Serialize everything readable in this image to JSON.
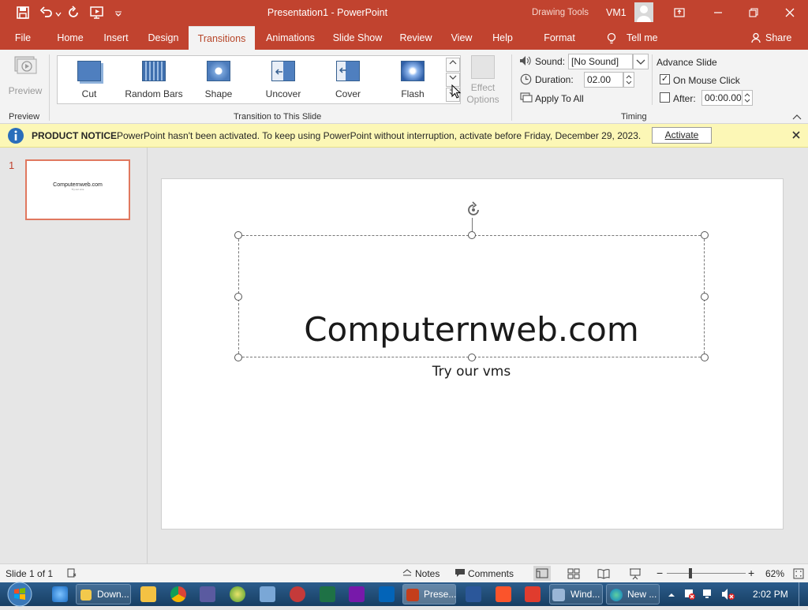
{
  "titlebar": {
    "title": "Presentation1  -  PowerPoint",
    "context_tools": "Drawing Tools",
    "user": "VM1",
    "minimize": "—",
    "restore": "❐",
    "close": "✕",
    "ribbon_display": "⬚"
  },
  "tabs": [
    {
      "label": "File"
    },
    {
      "label": "Home"
    },
    {
      "label": "Insert"
    },
    {
      "label": "Design"
    },
    {
      "label": "Transitions"
    },
    {
      "label": "Animations"
    },
    {
      "label": "Slide Show"
    },
    {
      "label": "Review"
    },
    {
      "label": "View"
    },
    {
      "label": "Help"
    },
    {
      "label": "Format"
    }
  ],
  "tell_me": "Tell me",
  "share": "Share",
  "ribbon": {
    "preview_label": "Preview",
    "preview_group": "Preview",
    "transitions": [
      {
        "label": "Cut"
      },
      {
        "label": "Random Bars"
      },
      {
        "label": "Shape"
      },
      {
        "label": "Uncover"
      },
      {
        "label": "Cover"
      },
      {
        "label": "Flash"
      }
    ],
    "effect_options_line1": "Effect",
    "effect_options_line2": "Options",
    "transition_group": "Transition to This Slide",
    "sound_label": "Sound:",
    "sound_value": "[No Sound]",
    "duration_label": "Duration:",
    "duration_value": "02.00",
    "apply_all": "Apply To All",
    "advance_title": "Advance Slide",
    "on_mouse_click": "On Mouse Click",
    "after_label": "After:",
    "after_value": "00:00.00",
    "timing_group": "Timing",
    "on_mouse_click_checked": true,
    "after_checked": false
  },
  "notice": {
    "title": "PRODUCT NOTICE",
    "message": "PowerPoint hasn't been activated. To keep using PowerPoint without interruption, activate before Friday, December 29, 2023.",
    "activate_label": "Activate"
  },
  "thumbnail": {
    "number": "1",
    "title": "Computernweb.com",
    "subtitle": "Try our vms"
  },
  "slide": {
    "title": "Computernweb.com",
    "subtitle": "Try our vms"
  },
  "status": {
    "slide_info": "Slide 1 of 1",
    "notes": "Notes",
    "comments": "Comments",
    "zoom_minus": "−",
    "zoom_plus": "+",
    "zoom": "62%"
  },
  "taskbar": {
    "downloads": "Down...",
    "presentation": "Prese...",
    "windows": "Wind...",
    "new": "New ...",
    "clock": "2:02 PM"
  },
  "colors": {
    "accent": "#c1432f",
    "notice_bg": "#fcf7b6",
    "taskbar": "#1f4f7a"
  }
}
